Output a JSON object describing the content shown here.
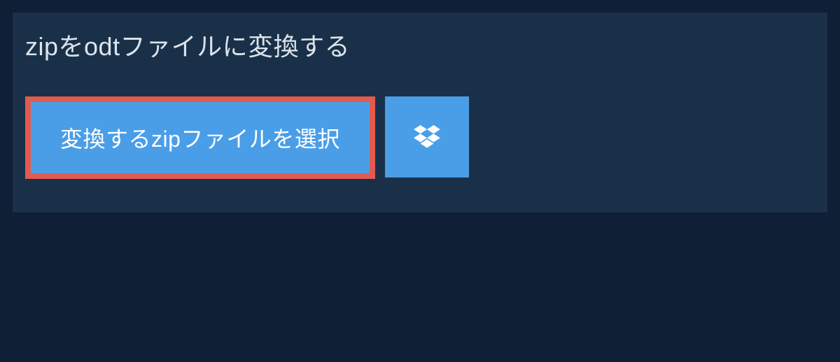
{
  "header": {
    "title": "zipをodtファイルに変換する"
  },
  "actions": {
    "select_file_label": "変換するzipファイルを選択"
  },
  "colors": {
    "background": "#0f1f35",
    "panel": "#1a3049",
    "button_primary": "#4a9ee8",
    "button_highlight_border": "#e25b4f",
    "text_light": "#dce3ea"
  }
}
